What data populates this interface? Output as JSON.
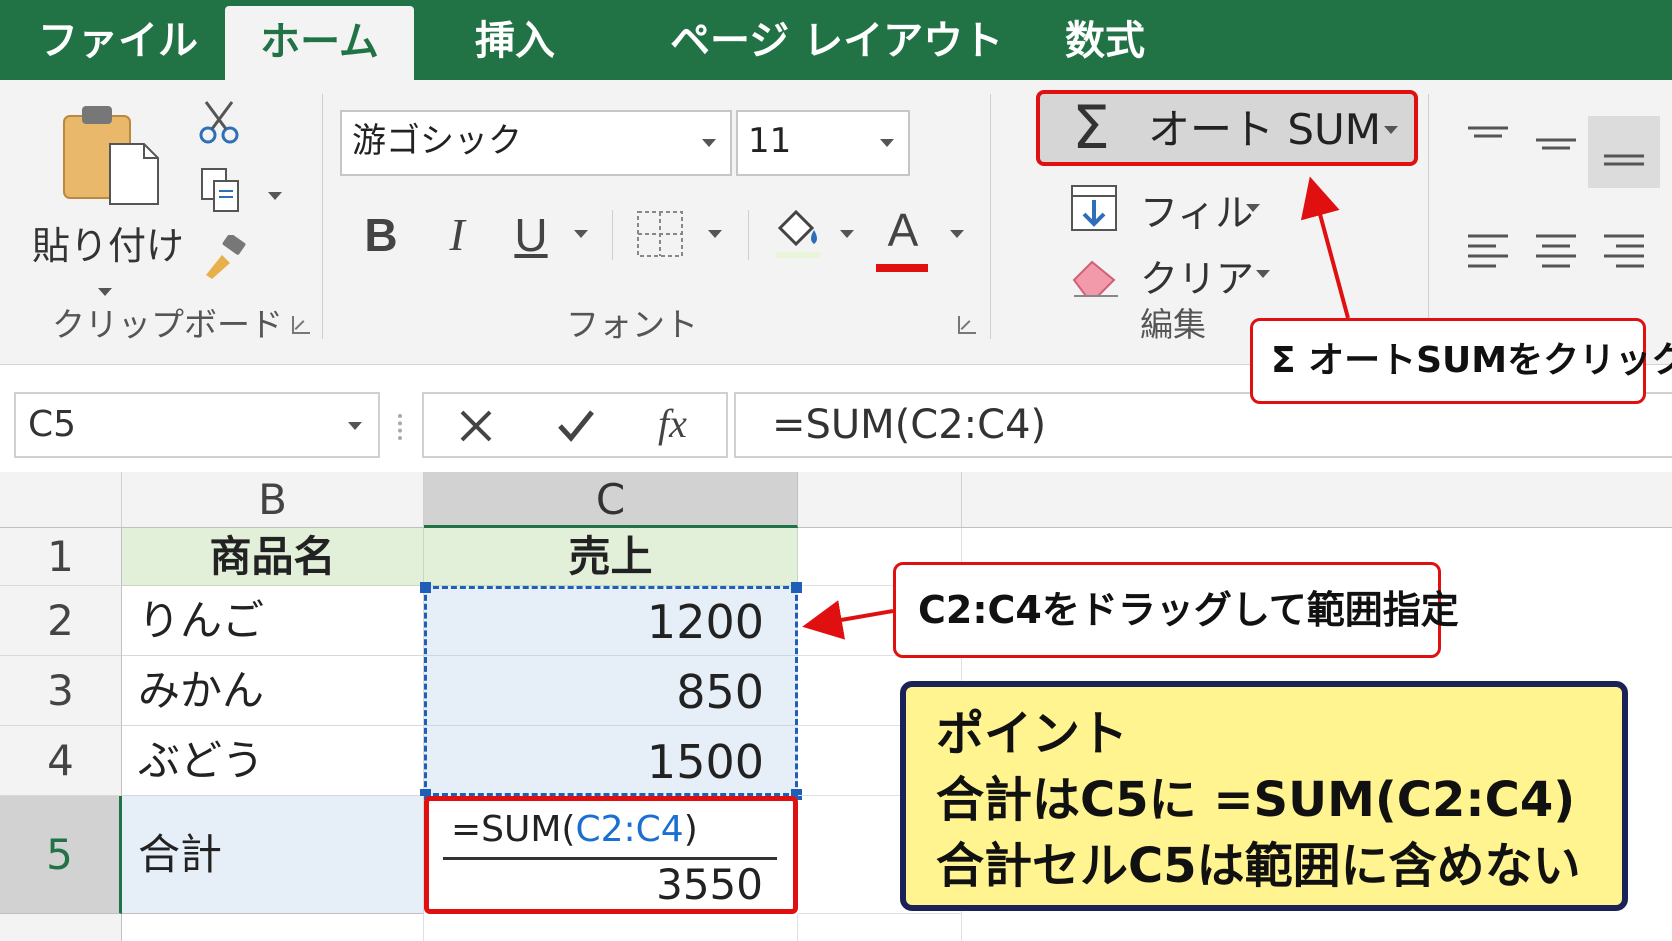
{
  "tabs": [
    {
      "label": "ファイル"
    },
    {
      "label": "ホーム"
    },
    {
      "label": "挿入"
    },
    {
      "label": "ページ レイアウト"
    },
    {
      "label": "数式"
    }
  ],
  "ribbon": {
    "clipboard": {
      "paste_label": "貼り付け",
      "group_label": "クリップボード"
    },
    "font": {
      "font_name": "游ゴシック",
      "font_size": "11",
      "bold": "B",
      "italic": "I",
      "underline": "U",
      "font_color_glyph": "A",
      "group_label": "フォント"
    },
    "editing": {
      "autosum_symbol": "Σ",
      "autosum_label": "オート SUM",
      "fill_label": "フィル",
      "clear_label": "クリア",
      "group_label": "編集"
    }
  },
  "formula_bar": {
    "name_box": "C5",
    "fx": "fx",
    "formula": "=SUM(C2:C4)"
  },
  "sheet": {
    "columns": [
      "B",
      "C"
    ],
    "rows": [
      {
        "num": "1",
        "b": "商品名",
        "c": "売上"
      },
      {
        "num": "2",
        "b": "りんご",
        "c": "1200"
      },
      {
        "num": "3",
        "b": "みかん",
        "c": "850"
      },
      {
        "num": "4",
        "b": "ぶどう",
        "c": "1500"
      },
      {
        "num": "5",
        "b": "合計",
        "c_formula_prefix": "=SUM(",
        "c_formula_ref": "C2:C4",
        "c_formula_suffix": ")",
        "c": "3550"
      }
    ]
  },
  "callouts": {
    "autosum": "Σ オートSUMをクリック",
    "range": "C2:C4をドラッグして範囲指定"
  },
  "point": {
    "title": "ポイント",
    "line1": "合計はC5に =SUM(C2:C4)",
    "line2": "合計セルC5は範囲に含めない"
  },
  "colors": {
    "excel_green": "#217346",
    "callout_red": "#e01010",
    "selection_blue": "#1f5fb8",
    "ref_blue": "#1a6fd0",
    "header_fill": "#e2f0d9",
    "point_fill": "#fff48f"
  }
}
